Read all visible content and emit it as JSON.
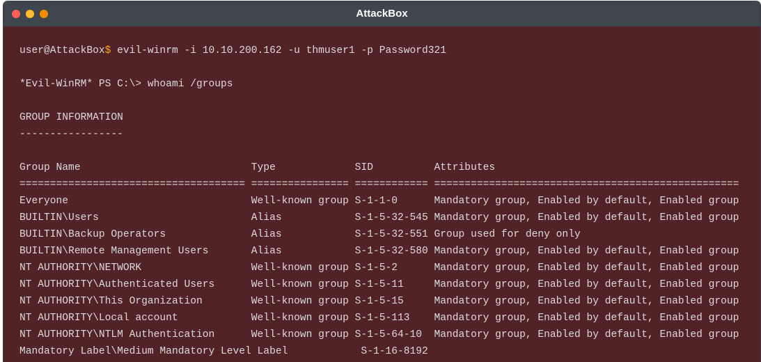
{
  "window": {
    "title": "AttackBox",
    "dot_colors": {
      "close": "#ff5f57",
      "minimize": "#febc2e",
      "zoom": "#f38b00"
    }
  },
  "terminal": {
    "background": "#512327",
    "text_color": "#dedad6",
    "prompt_color": "#f5a623",
    "prompt": {
      "user_host": "user@AttackBox",
      "symbol": "$",
      "command": " evil-winrm -i 10.10.200.162 -u thmuser1 -p Password321"
    },
    "ps_command_line": "*Evil-WinRM* PS C:\\> whoami /groups",
    "section_title": "GROUP INFORMATION",
    "section_underline": "-----------------",
    "table_header": "Group Name                            Type             SID          Attributes",
    "table_separator": "===================================== ================ ============ ==================================================",
    "rows": [
      "Everyone                              Well-known group S-1-1-0      Mandatory group, Enabled by default, Enabled group",
      "BUILTIN\\Users                         Alias            S-1-5-32-545 Mandatory group, Enabled by default, Enabled group",
      "BUILTIN\\Backup Operators              Alias            S-1-5-32-551 Group used for deny only",
      "BUILTIN\\Remote Management Users       Alias            S-1-5-32-580 Mandatory group, Enabled by default, Enabled group",
      "NT AUTHORITY\\NETWORK                  Well-known group S-1-5-2      Mandatory group, Enabled by default, Enabled group",
      "NT AUTHORITY\\Authenticated Users      Well-known group S-1-5-11     Mandatory group, Enabled by default, Enabled group",
      "NT AUTHORITY\\This Organization        Well-known group S-1-5-15     Mandatory group, Enabled by default, Enabled group",
      "NT AUTHORITY\\Local account            Well-known group S-1-5-113    Mandatory group, Enabled by default, Enabled group",
      "NT AUTHORITY\\NTLM Authentication      Well-known group S-1-5-64-10  Mandatory group, Enabled by default, Enabled group",
      "Mandatory Label\\Medium Mandatory Level Label            S-1-16-8192"
    ]
  }
}
